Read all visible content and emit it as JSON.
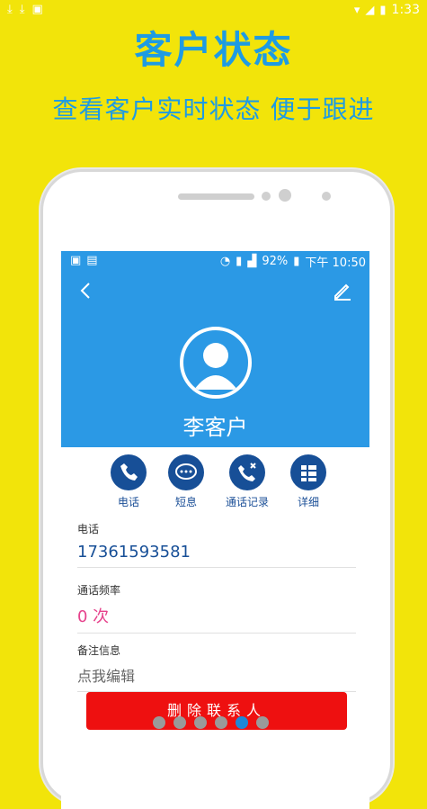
{
  "device_status": {
    "time": "1:33"
  },
  "headline": {
    "title": "客户状态",
    "subtitle": "查看客户实时状态 便于跟进"
  },
  "screen": {
    "status": {
      "battery": "92%",
      "time": "下午 10:50"
    },
    "contact_name": "李客户",
    "actions": [
      {
        "label": "电话",
        "icon": "phone-icon"
      },
      {
        "label": "短息",
        "icon": "message-icon"
      },
      {
        "label": "通话记录",
        "icon": "call-log-icon"
      },
      {
        "label": "详细",
        "icon": "details-icon"
      }
    ],
    "fields": [
      {
        "label": "电话",
        "value": "17361593581"
      },
      {
        "label": "通话频率",
        "value": "0 次"
      },
      {
        "label": "备注信息",
        "value": "点我编辑"
      }
    ],
    "delete_button": "删除联系人"
  },
  "colors": {
    "background": "#f2e40a",
    "accent": "#1e9be3",
    "header": "#2b99e5",
    "danger": "#ee1010"
  },
  "pager": {
    "count": 6,
    "active_index": 4
  }
}
